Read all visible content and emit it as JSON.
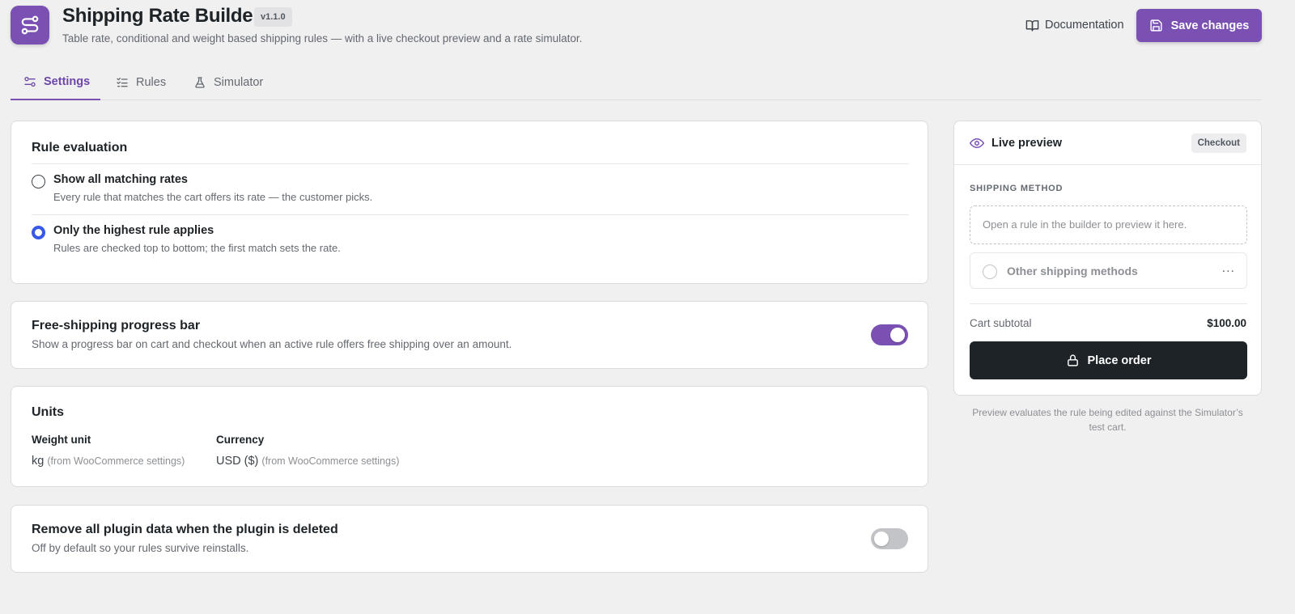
{
  "header": {
    "title": "Shipping Rate Builder",
    "version": "v1.1.0",
    "subtitle": "Table rate, conditional and weight based shipping rules — with a live checkout preview and a rate simulator.",
    "doc_label": "Documentation",
    "save_label": "Save changes",
    "logo_icon": "route-icon",
    "accent": "#7a51b3"
  },
  "tabs": [
    {
      "label": "Settings",
      "icon": "sliders-icon",
      "active": true
    },
    {
      "label": "Rules",
      "icon": "checklist-icon",
      "active": false
    },
    {
      "label": "Simulator",
      "icon": "flask-icon",
      "active": false
    }
  ],
  "rule_evaluation": {
    "title": "Rule evaluation",
    "options": [
      {
        "label": "Show all matching rates",
        "desc": "Every rule that matches the cart offers its rate — the customer picks.",
        "selected": false
      },
      {
        "label": "Only the highest rule applies",
        "desc": "Rules are checked top to bottom; the first match sets the rate.",
        "selected": true
      }
    ]
  },
  "progress_bar": {
    "title": "Free-shipping progress bar",
    "desc": "Show a progress bar on cart and checkout when an active rule offers free shipping over an amount.",
    "enabled": true
  },
  "units": {
    "title": "Units",
    "weight_label": "Weight unit",
    "weight_value": "kg",
    "weight_note": "(from WooCommerce settings)",
    "currency_label": "Currency",
    "currency_value": "USD ($)",
    "currency_note": "(from WooCommerce settings)"
  },
  "remove_data": {
    "title": "Remove all plugin data when the plugin is deleted",
    "desc": "Off by default so your rules survive reinstalls.",
    "enabled": false
  },
  "preview": {
    "title": "Live preview",
    "badge": "Checkout",
    "section_label": "SHIPPING METHOD",
    "empty_text": "Open a rule in the builder to preview it here.",
    "other_methods": "Other shipping methods",
    "other_dots": "...",
    "subtotal_label": "Cart subtotal",
    "subtotal_value": "$100.00",
    "place_order": "Place order",
    "note": "Preview evaluates the rule being edited against the Simulator’s test cart."
  }
}
